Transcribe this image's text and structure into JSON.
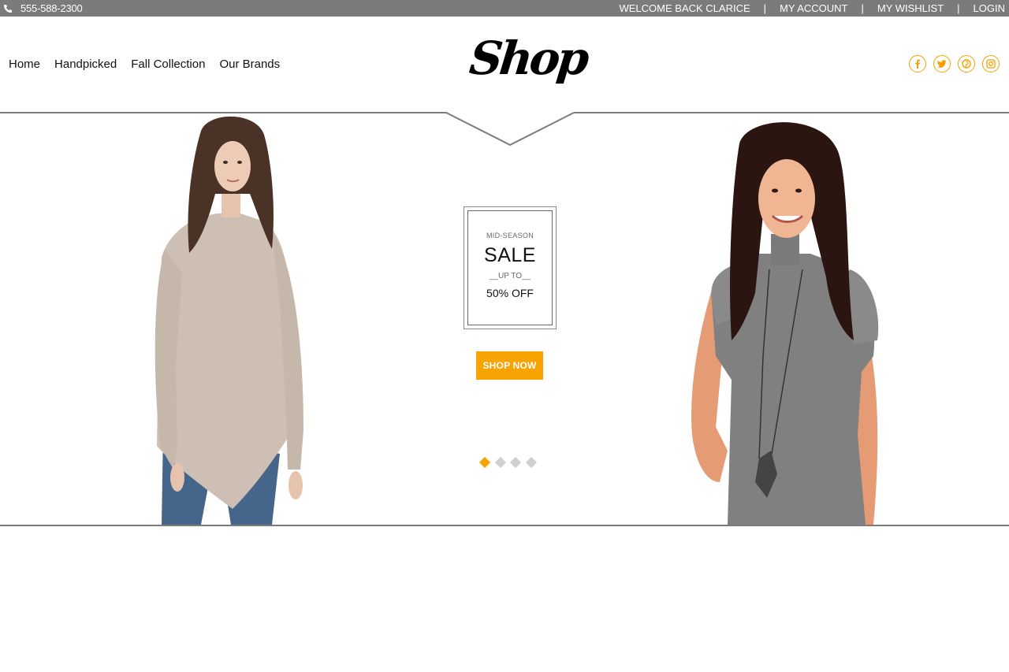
{
  "topbar": {
    "phone": "555-588-2300",
    "links": [
      "WELCOME BACK CLARICE",
      "MY ACCOUNT",
      "MY WISHLIST",
      "LOGIN"
    ],
    "separator": "|"
  },
  "nav": {
    "items": [
      "Home",
      "Handpicked",
      "Fall Collection",
      "Our Brands"
    ]
  },
  "logo": {
    "text": "Shop"
  },
  "social": {
    "icons": [
      "facebook-icon",
      "twitter-icon",
      "pinterest-icon",
      "instagram-icon"
    ],
    "color": "#f5a000"
  },
  "hero": {
    "promo": {
      "pre": "MID-SEASON",
      "main": "SALE",
      "upto": "__UP TO__",
      "discount": "50% OFF"
    },
    "cta": "SHOP NOW",
    "slides": 4,
    "active_slide": 1,
    "accent": "#f9a300"
  }
}
